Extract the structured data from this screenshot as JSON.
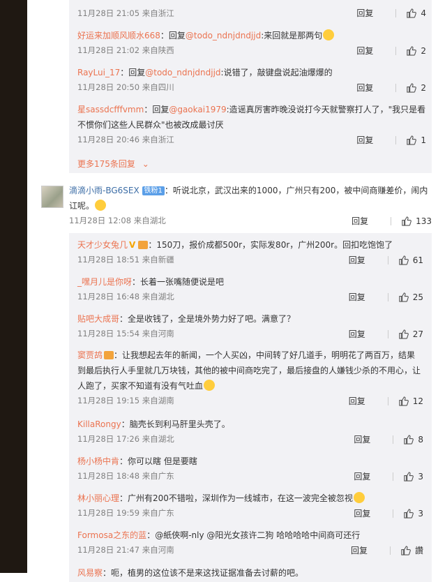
{
  "top_replies": [
    {
      "user": "",
      "prefix": "",
      "text": "",
      "time": "11月28日 21:05 来自浙江",
      "likes": "4",
      "partial": true
    },
    {
      "user": "好运来加顺风顺水668",
      "prefix": "：回复",
      "mention": "@todo_ndnjdndjjd",
      "text": ":来回就是那两句",
      "time": "11月28日 21:02 来自陕西",
      "likes": "2"
    },
    {
      "user": "RayLui_17",
      "prefix": "：回复",
      "mention": "@todo_ndnjdndjjd",
      "text": ":说错了，敲键盘说起油爆爆的",
      "time": "11月28日 20:50 来自四川",
      "likes": "2"
    },
    {
      "user": "星sassdcfffvmm",
      "prefix": "：回复",
      "mention": "@gaokai1979",
      "text": ":造谣真厉害昨晚没说打今天就警察打人了，\"我只是看不惯你们这些人民群众\"也被改成最讨厌",
      "time": "11月28日 20:46 来自浙江",
      "likes": "1"
    }
  ],
  "more_replies": "更多175条回复",
  "comment": {
    "user": "滴滴小雨-BG6SEX",
    "badge": "铁粉1",
    "text": "：听说北京，武汉出来的1000，广州只有200，被中间商赚差价，闹内讧呢。",
    "time": "11月28日 12:08 来自湖北",
    "reply_label": "回复",
    "likes": "133"
  },
  "replies": [
    {
      "user": "天才少女兔几",
      "text": "：150刀，报价成都500r，实际发80r，广州200r。回扣吃饱饱了",
      "time": "11月28日 18:51 来自新疆",
      "likes": "61"
    },
    {
      "user": "_嘿月儿是你呀",
      "text": "：长着一张嘴随便说是吧",
      "time": "11月28日 16:48 来自湖北",
      "likes": "25"
    },
    {
      "user": "贴吧大成哥",
      "text": "：全是收钱了，全是境外势力好了吧。满意了？",
      "time": "11月28日 15:54 来自河南",
      "likes": "27"
    },
    {
      "user": "窦贾鸪",
      "text": "：让我想起去年的新闻，一个人买凶，中间转了好几道手，明明花了两百万，结果到最后执行人手里就几万块钱，其他的被中间商吃完了，最后接盘的人嫌钱少杀的不用心，让人跑了，买家不知道有没有气吐血",
      "time": "11月28日 19:15 来自湖南",
      "likes": "12"
    },
    {
      "user": "KillaRongy",
      "text": "：脑壳长到利马肝里头壳了。",
      "time": "11月28日 17:26 来自湖北",
      "likes": "8"
    },
    {
      "user": "杨小杨中肯",
      "text": "：你可以瞎 但是要瞎",
      "time": "11月28日 18:48 来自广东",
      "likes": "3"
    },
    {
      "user": "林小丽心理",
      "text": "：广州有200不错啦，深圳作为一线城市，在这一波完全被忽视",
      "time": "11月28日 19:59 来自广东",
      "likes": "3"
    },
    {
      "user": "Formosa之东的蓝",
      "text": "：@紙俠啊-nly @阳光女孩许二狗 哈哈哈哈中间商可还行",
      "time": "11月28日 21:47 来自河南",
      "likes": "讚"
    },
    {
      "user": "风易察",
      "text": "：呃，植男的这位该不是来这找证据准备去讨薪的吧。",
      "time": "",
      "likes": "",
      "partial": true
    }
  ],
  "reply_label": "回复"
}
